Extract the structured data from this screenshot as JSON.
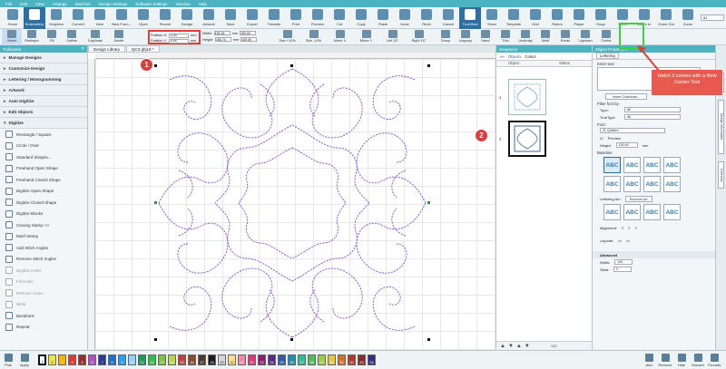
{
  "menu": [
    "File",
    "Edit",
    "View",
    "Arrange",
    "Machine",
    "Design Settings",
    "Software Settings",
    "Window",
    "Help"
  ],
  "ribbon_top": [
    {
      "label": "Home",
      "icon": "home-icon"
    },
    {
      "label": "Embroidery",
      "icon": "embroidery-icon",
      "active": true
    },
    {
      "label": "Graphics",
      "icon": "graphics-icon"
    },
    {
      "label": "Convert",
      "icon": "convert-icon"
    },
    {
      "label": "New",
      "icon": "new-icon"
    },
    {
      "label": "New From...",
      "icon": "new-from-icon"
    },
    {
      "label": "Open",
      "icon": "open-icon"
    },
    {
      "label": "Recent",
      "icon": "recent-icon"
    },
    {
      "label": "Design",
      "icon": "design-icon"
    },
    {
      "label": "Artwork",
      "icon": "artwork-icon"
    },
    {
      "label": "Save",
      "icon": "save-icon"
    },
    {
      "label": "Export",
      "icon": "export-icon"
    },
    {
      "label": "Transfer",
      "icon": "transfer-icon"
    },
    {
      "label": "Print",
      "icon": "print-icon"
    },
    {
      "label": "Preview",
      "icon": "preview-icon"
    },
    {
      "label": "Cut",
      "icon": "cut-icon"
    },
    {
      "label": "Copy",
      "icon": "copy-icon"
    },
    {
      "label": "Paste",
      "icon": "paste-icon"
    },
    {
      "label": "Undo",
      "icon": "undo-icon"
    },
    {
      "label": "Redo",
      "icon": "redo-icon"
    },
    {
      "label": "Cancel",
      "icon": "cancel-icon"
    },
    {
      "label": "TrueView",
      "icon": "trueview-icon",
      "active": true
    },
    {
      "label": "Show",
      "icon": "show-icon"
    },
    {
      "label": "Template",
      "icon": "template-icon"
    },
    {
      "label": "Grid",
      "icon": "grid-icon"
    },
    {
      "label": "Rulers",
      "icon": "rulers-icon"
    },
    {
      "label": "Player",
      "icon": "player-icon"
    },
    {
      "label": "Hoop",
      "icon": "hoop-icon"
    },
    {
      "label": "100%",
      "icon": "zoom-100-icon"
    },
    {
      "label": "Zoom In",
      "icon": "zoom-in-icon"
    },
    {
      "label": "Zoom Out",
      "icon": "zoom-out-icon"
    },
    {
      "label": "Zoom",
      "icon": "zoom-icon"
    }
  ],
  "zoom_value": "81",
  "ribbon_second": [
    {
      "label": "Select"
    },
    {
      "label": "Reshape"
    },
    {
      "label": "Fill"
    },
    {
      "label": "Outline"
    },
    {
      "label": "Duplicate"
    },
    {
      "label": "Delete"
    }
  ],
  "position": {
    "x_label": "Position X:",
    "x_value": "0.00",
    "y_label": "Position Y:",
    "y_value": "0.00",
    "unit": "mm"
  },
  "size": {
    "w_label": "Width:",
    "w_value": "150.16",
    "h_label": "Height:",
    "h_value": "150.74",
    "w_pct": "100.00",
    "h_pct": "100.00",
    "unit": "mm"
  },
  "ribbon_transform": [
    "Size +10%",
    "Size -10%",
    "Mirror X",
    "Mirror Y",
    "Left 15°",
    "Right 15°"
  ],
  "ribbon_right": [
    "Group",
    "Ungroup",
    "Hand",
    "Trim",
    "Underlay",
    "Motif",
    "Break",
    "Laydown",
    "Center"
  ],
  "left_pane": {
    "title": "Toolboxes",
    "sections": [
      "Manage Designs",
      "Customize Design",
      "Lettering / Monogramming",
      "Artwork",
      "Auto Digitize",
      "Edit Objects",
      "Digitize"
    ],
    "tools": [
      {
        "label": "Rectangle / Square",
        "dim": false
      },
      {
        "label": "Circle / Oval",
        "dim": false
      },
      {
        "label": "Standard Shapes...",
        "dim": false
      },
      {
        "label": "Freehand Open Shape",
        "dim": false
      },
      {
        "label": "Freehand Closed Shape",
        "dim": false
      },
      {
        "label": "Digitize Open Shape",
        "dim": false
      },
      {
        "label": "Digitize Closed Shape",
        "dim": false
      },
      {
        "label": "Digitize Blocks",
        "dim": false
      },
      {
        "label": "Carving Stamp >>",
        "dim": false
      },
      {
        "label": "Motif Stamp",
        "dim": false
      },
      {
        "label": "Add Stitch Angles",
        "dim": false
      },
      {
        "label": "Remove Stitch Angles",
        "dim": false
      },
      {
        "label": "Digitize Holes",
        "dim": true
      },
      {
        "label": "Fill Holes",
        "dim": true
      },
      {
        "label": "Remove Holes",
        "dim": true
      },
      {
        "label": "Weld",
        "dim": true
      },
      {
        "label": "Backtrack",
        "dim": false
      },
      {
        "label": "Repeat",
        "dim": false
      }
    ]
  },
  "canvas_tabs": [
    "Design Library",
    "QC3 ghj19 *"
  ],
  "sequence": {
    "title": "Sequence",
    "tabs": [
      "Objects",
      "Colors"
    ],
    "columns": [
      "",
      "Object",
      "Status"
    ],
    "rows": [
      "1",
      "2"
    ],
    "footer_count": "123"
  },
  "props": {
    "title": "Object Properties",
    "tab": "Lettering",
    "enter_text": "Enter text:",
    "insert_btn": "Insert Character...",
    "filter_label": "Filter font by:",
    "type_label": "Type:",
    "type_value": "All",
    "truetype_label": "TrueType",
    "truetype_value": "All",
    "font_label": "Font:",
    "font_value": "ZL Quilters",
    "preview_label": "Preview",
    "height_label": "Height:",
    "height_value": "130.00",
    "height_unit": "mm",
    "baseline_label": "Baseline:",
    "abc_tiles": [
      "ABC",
      "ABC",
      "ABC",
      "ABC",
      "ABC",
      "ABC",
      "ABC",
      "ABC"
    ],
    "lettering_art_label": "Lettering Art:",
    "remove_art_btn": "Remove Art",
    "art_tiles": [
      "ABC",
      "ABC",
      "ABC",
      "ABC"
    ],
    "alignment_label": "Alignment:",
    "layouts_label": "Layouts:",
    "advanced_label": "Advanced",
    "width_label": "Width:",
    "width_value": "100",
    "slant_label": "Slant:",
    "slant_value": "0",
    "side_tabs": [
      "Hints",
      "Design Information",
      "Overview"
    ]
  },
  "bottombar": {
    "tools_left": [
      "Pick",
      "Apply"
    ],
    "swatches": [
      {
        "n": "1",
        "color": "#ffffff"
      },
      {
        "n": "2",
        "color": "#f0e442"
      },
      {
        "n": "3",
        "color": "#f5b400"
      },
      {
        "n": "4",
        "color": "#e03a2e"
      },
      {
        "n": "5",
        "color": "#9b2d2d"
      },
      {
        "n": "6",
        "color": "#b24fc6"
      },
      {
        "n": "7",
        "color": "#2a3a8c"
      },
      {
        "n": "8",
        "color": "#1f6fd1"
      },
      {
        "n": "9",
        "color": "#2a9df4"
      },
      {
        "n": "10",
        "color": "#8fd0ff"
      },
      {
        "n": "11",
        "color": "#1f9a5a"
      },
      {
        "n": "12",
        "color": "#2fbf4a"
      },
      {
        "n": "13",
        "color": "#7cc242"
      },
      {
        "n": "14",
        "color": "#b9d54c"
      },
      {
        "n": "15",
        "color": "#c04040"
      },
      {
        "n": "16",
        "color": "#8a4c2b"
      },
      {
        "n": "17",
        "color": "#4e3a2a"
      },
      {
        "n": "18",
        "color": "#1c1c1c"
      },
      {
        "n": "19",
        "color": "#d4d4d4"
      },
      {
        "n": "20",
        "color": "#ffde8a"
      },
      {
        "n": "21",
        "color": "#f08aa4"
      },
      {
        "n": "22",
        "color": "#e6367a"
      },
      {
        "n": "23",
        "color": "#8c1f6b"
      },
      {
        "n": "24",
        "color": "#5c2a86"
      },
      {
        "n": "25",
        "color": "#2b5dad"
      },
      {
        "n": "26",
        "color": "#1c8fb0"
      },
      {
        "n": "27",
        "color": "#2abf9a"
      },
      {
        "n": "28",
        "color": "#4fbd59"
      },
      {
        "n": "29",
        "color": "#9ccf3f"
      },
      {
        "n": "30",
        "color": "#e8c43a"
      },
      {
        "n": "31",
        "color": "#d8702a"
      },
      {
        "n": "32",
        "color": "#b33a2a"
      },
      {
        "n": "33",
        "color": "#8a2a2a"
      },
      {
        "n": "34",
        "color": "#3a2a8a"
      }
    ],
    "tools_right": [
      "Add",
      "Remove",
      "Hide",
      "Discard",
      "Threads"
    ]
  },
  "annotations": {
    "callout_1": "1",
    "callout_2": "2",
    "callout_text": "Hatch 3 comes with a New Center Tool"
  }
}
